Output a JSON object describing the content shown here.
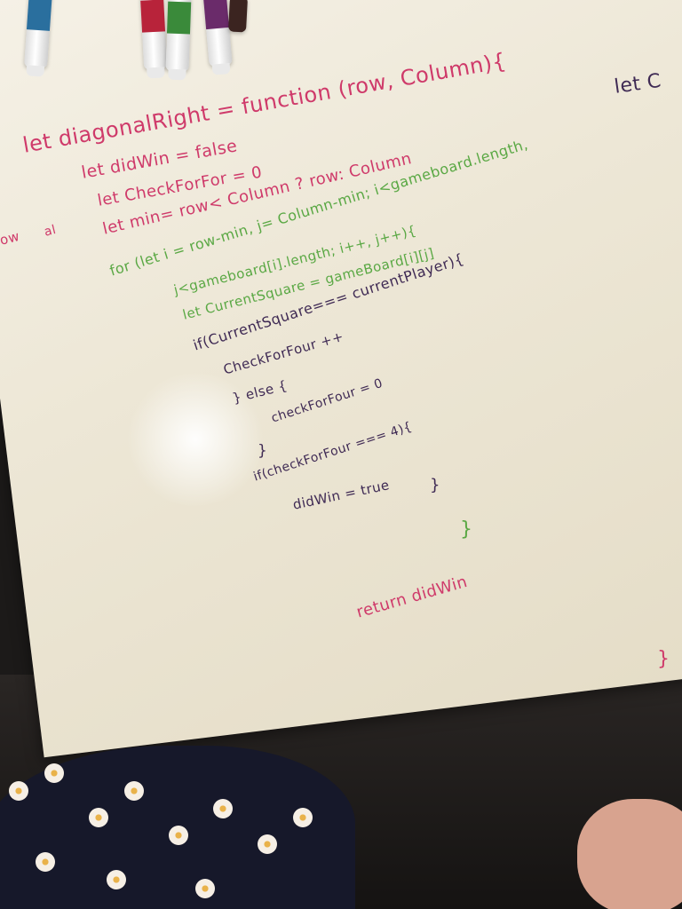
{
  "whiteboard": {
    "lines": [
      {
        "id": "line-1",
        "text": "let diagonalRight = function (row, Column){",
        "color": "pink"
      },
      {
        "id": "line-2",
        "text": "let didWin = false",
        "color": "pink"
      },
      {
        "id": "line-3",
        "text": "let CheckForFor = 0",
        "color": "pink"
      },
      {
        "id": "line-4",
        "text": "let min= row< Column ? row: Column",
        "color": "pink"
      },
      {
        "id": "line-5",
        "text": "for (let i = row-min, j= Column-min; i<gameboard.length,",
        "color": "green"
      },
      {
        "id": "line-6",
        "text": "j<gameboard[i].length; i++, j++){",
        "color": "green"
      },
      {
        "id": "line-7",
        "text": "let CurrentSquare = gameBoard[i][j]",
        "color": "green"
      },
      {
        "id": "line-8",
        "text": "if(CurrentSquare=== currentPlayer){",
        "color": "purple"
      },
      {
        "id": "line-9",
        "text": "CheckForFour ++",
        "color": "purple"
      },
      {
        "id": "line-10",
        "text": "} else {",
        "color": "purple"
      },
      {
        "id": "line-11",
        "text": "checkForFour = 0",
        "color": "purple"
      },
      {
        "id": "line-12",
        "text": "}",
        "color": "purple"
      },
      {
        "id": "line-13",
        "text": "if(checkForFour === 4){",
        "color": "purple"
      },
      {
        "id": "line-14",
        "text": "didWin = true",
        "color": "purple"
      },
      {
        "id": "line-15",
        "text": "}",
        "color": "purple"
      },
      {
        "id": "line-16",
        "text": "}",
        "color": "green"
      },
      {
        "id": "line-17",
        "text": "return didWin",
        "color": "pink"
      },
      {
        "id": "line-18",
        "text": "}",
        "color": "pink"
      }
    ],
    "side_text_left": "ow",
    "side_text_left_2": "al",
    "side_text_right": "let C"
  },
  "colors": {
    "pink_ink": "#cf3a6a",
    "green_ink": "#5aa844",
    "purple_ink": "#3f2a54",
    "board": "#f3eee2"
  },
  "markers": [
    {
      "id": "marker-blue",
      "band_color": "#2a6f9e"
    },
    {
      "id": "marker-red",
      "band_color": "#b8233a"
    },
    {
      "id": "marker-green",
      "band_color": "#3a8a3a"
    },
    {
      "id": "marker-purple",
      "band_color": "#6a2b6a"
    },
    {
      "id": "marker-dark",
      "band_color": "#3b2420"
    }
  ]
}
